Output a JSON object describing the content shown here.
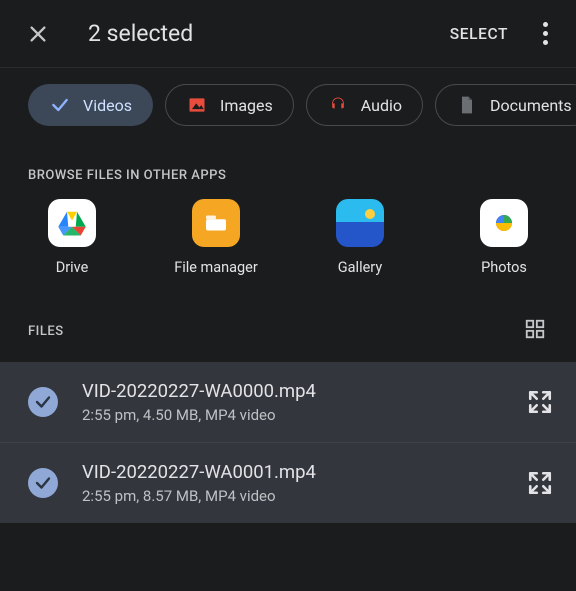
{
  "header": {
    "title": "2 selected",
    "select_label": "SELECT"
  },
  "chips": [
    {
      "label": "Videos",
      "icon": "check-icon",
      "selected": true
    },
    {
      "label": "Images",
      "icon": "image-icon",
      "selected": false
    },
    {
      "label": "Audio",
      "icon": "audio-icon",
      "selected": false
    },
    {
      "label": "Documents",
      "icon": "document-icon",
      "selected": false
    }
  ],
  "browse_label": "BROWSE FILES IN OTHER APPS",
  "apps": [
    {
      "name": "Drive"
    },
    {
      "name": "File manager"
    },
    {
      "name": "Gallery"
    },
    {
      "name": "Photos"
    }
  ],
  "files_label": "FILES",
  "files": [
    {
      "name": "VID-20220227-WA0000.mp4",
      "meta": "2:55 pm, 4.50 MB, MP4 video",
      "selected": true
    },
    {
      "name": "VID-20220227-WA0001.mp4",
      "meta": "2:55 pm, 8.57 MB, MP4 video",
      "selected": true
    }
  ]
}
